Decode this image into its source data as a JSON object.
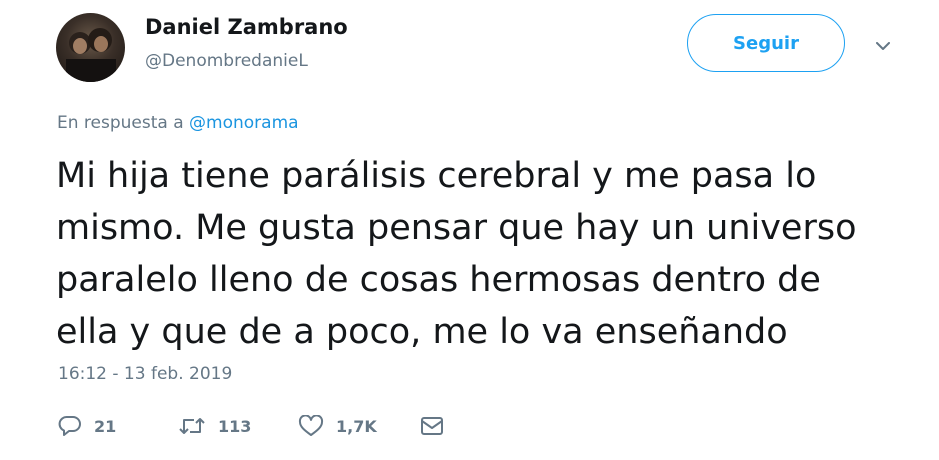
{
  "author": {
    "name": "Daniel Zambrano",
    "handle": "@DenombredanieL"
  },
  "follow_button": {
    "label": "Seguir"
  },
  "reply_context": {
    "prefix": "En respuesta a",
    "mention": "@monorama"
  },
  "tweet": {
    "lines": [
      "Mi hija tiene parálisis cerebral y me pasa lo",
      "mismo. Me gusta pensar que hay un universo",
      "paralelo lleno de cosas hermosas dentro de",
      "ella y que de a poco, me lo va enseñando"
    ],
    "timestamp": "16:12 - 13 feb. 2019"
  },
  "actions": {
    "replies": "21",
    "retweets": "113",
    "likes": "1,7K"
  },
  "colors": {
    "accent": "#1da1f2",
    "mention": "#1b95e0",
    "muted": "#657786",
    "text": "#14171a"
  },
  "icons": [
    "avatar",
    "chevron-down-icon",
    "reply-icon",
    "retweet-icon",
    "heart-icon",
    "envelope-icon"
  ]
}
